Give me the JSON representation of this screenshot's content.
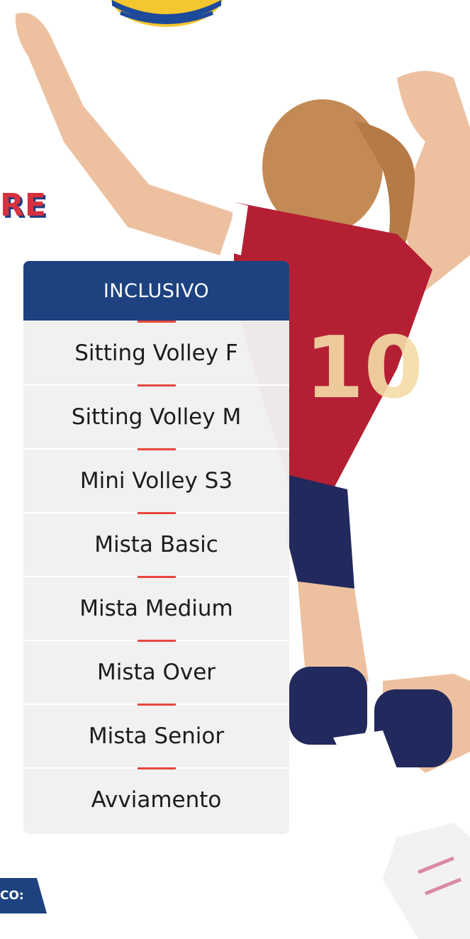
{
  "heading": {
    "fragment": "RE"
  },
  "panel": {
    "header": "INCLUSIVO",
    "items": [
      {
        "label": "Sitting Volley F"
      },
      {
        "label": "Sitting Volley M"
      },
      {
        "label": "Mini Volley S3"
      },
      {
        "label": "Mista Basic"
      },
      {
        "label": "Mista Medium"
      },
      {
        "label": "Mista Over"
      },
      {
        "label": "Mista Senior"
      },
      {
        "label": "Avviamento"
      }
    ]
  },
  "footer": {
    "tag": "CO:"
  },
  "colors": {
    "brand_blue": "#1d427f",
    "accent_red": "#e8473f",
    "heading_red": "#d7303e",
    "panel_bg": "#f0f0f0"
  },
  "icons": [
    "volleyball-icon"
  ]
}
